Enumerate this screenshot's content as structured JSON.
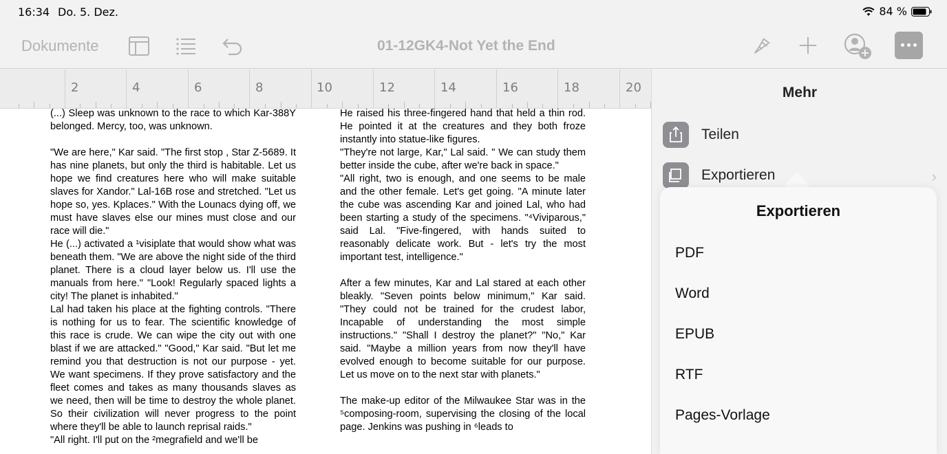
{
  "status": {
    "time": "16:34",
    "date": "Do. 5. Dez.",
    "battery": "84 %"
  },
  "toolbar": {
    "documents_label": "Dokumente",
    "doc_title": "01-12GK4-Not Yet the End"
  },
  "ruler": {
    "labels": [
      "2",
      "4",
      "6",
      "8",
      "10",
      "12",
      "14",
      "16",
      "18",
      "20"
    ]
  },
  "panel": {
    "title": "Mehr",
    "share_label": "Teilen",
    "export_label": "Exportieren"
  },
  "export_menu": {
    "title": "Exportieren",
    "items": [
      "PDF",
      "Word",
      "EPUB",
      "RTF",
      "Pages-Vorlage"
    ]
  },
  "document": {
    "left": [
      "(...) Sleep was unknown to the race to which Kar-388Y belonged. Mercy, too, was unknown.",
      "\"We are here,\" Kar said. \"The first stop , Star Z-5689. It has nine planets, but only the third is habitable. Let us  hope we find creatures here who will make suitable slaves for Xandor.\" Lal-16B rose and stretched. \"Let us hope so, yes. Kplaces.\" With the Lounacs dying off, we must have slaves else our mines must close and our race will die.\"",
      "He (...) activated a ¹visiplate that would show what was beneath them. \"We are above the night side of the third planet. There is a cloud layer below us. I'll use the manuals from here.\" \"Look! Regularly spaced lights a city! The planet is inhabited.\"",
      "Lal had taken his place at the fighting controls. \"There is nothing for us to fear. The scientific knowledge of this race is crude. We can wipe the city out with one blast if we are attacked.\" \"Good,\" Kar said. \"But let me remind you that destruction is not our purpose - yet. We want specimens. If they prove satisfactory and the fleet comes and takes as many thousands slaves as we need, then will be time to destroy the whole planet. So their civilization will never progress to the point where they'll be able to launch reprisal raids.\"",
      "\"All right. I'll put on the ²megrafield and we'll be"
    ],
    "right": [
      "He raised his three-fingered hand that held a thin rod. He  pointed it at the creatures and they both froze instantly into statue-like figures.",
      "\"They're not large, Kar,\" Lal said. \" We can study them better inside the cube, after we're back in space.\"",
      "\"All right, two is enough, and one seems to be male and the other female. Let's get going. \"A minute later the cube was ascending Kar and joined  Lal, who had been starting a study of the specimens. \"⁴Viviparous,\" said Lal. \"Five-fingered, with hands suited to reasonably delicate work. But - let's  try the most important test, intelligence.\"",
      " After a few minutes, Kar and Lal stared at each other bleakly. \"Seven points below minimum,\" Kar said. \"They could not be trained for the crudest labor, Incapable of understanding the most simple instructions.\" \"Shall I destroy the planet?\" \"No,\" Kar said. \"Maybe a million years from now they'll have evolved enough to become suitable for our purpose. Let us move on to the next star with planets.\"",
      "The make-up editor of the Milwaukee Star  was in the ⁵composing-room, supervising the closing of the local page. Jenkins was pushing in ⁶leads to"
    ]
  }
}
